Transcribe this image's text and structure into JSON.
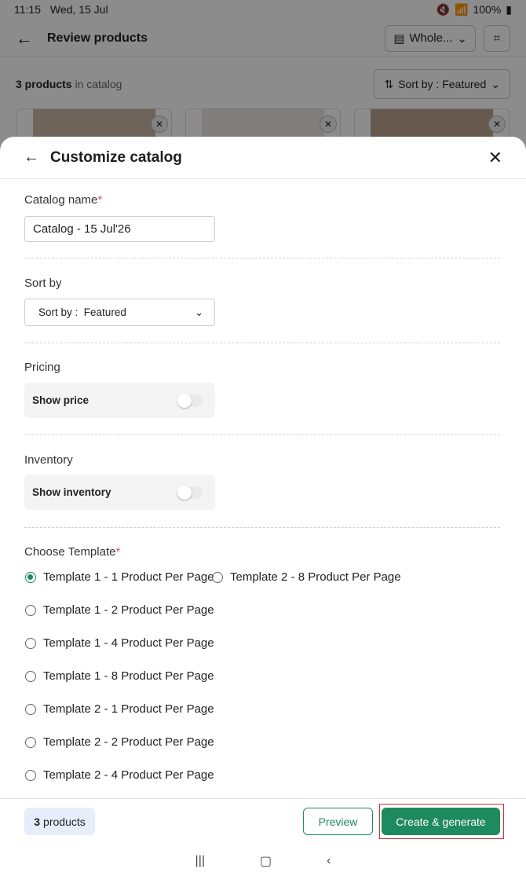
{
  "status_bar": {
    "time": "11:15",
    "date": "Wed, 15 Jul",
    "battery": "100%"
  },
  "app_header": {
    "title": "Review products",
    "warehouse": "Whole..."
  },
  "bg_toolbar": {
    "count_bold": "3 products",
    "count_rest": "in catalog",
    "sort": "Sort by : Featured"
  },
  "sheet": {
    "title": "Customize catalog",
    "catalog_name_label": "Catalog name",
    "catalog_name_value": "Catalog - 15 Jul'26",
    "sort_label": "Sort by",
    "sort_prefix": "Sort by :",
    "sort_value": "Featured",
    "pricing_label": "Pricing",
    "show_price": "Show price",
    "inventory_label": "Inventory",
    "show_inventory": "Show inventory",
    "template_label": "Choose Template",
    "templates": [
      "Template 1 - 1 Product Per Page",
      "Template 2 - 8 Product Per Page",
      "Template 1 - 2 Product Per Page",
      "Template 1 - 4 Product Per Page",
      "Template 1 - 8 Product Per Page",
      "Template 2 - 1 Product Per Page",
      "Template 2 - 2 Product Per Page",
      "Template 2 - 4 Product Per Page"
    ],
    "selected_template": "Template 1 - 1 Product Per Page"
  },
  "footer": {
    "count_num": "3",
    "count_label": "products",
    "preview": "Preview",
    "create": "Create & generate"
  },
  "colors": {
    "accent": "#1e8a5f",
    "highlight": "#d32f2f"
  }
}
